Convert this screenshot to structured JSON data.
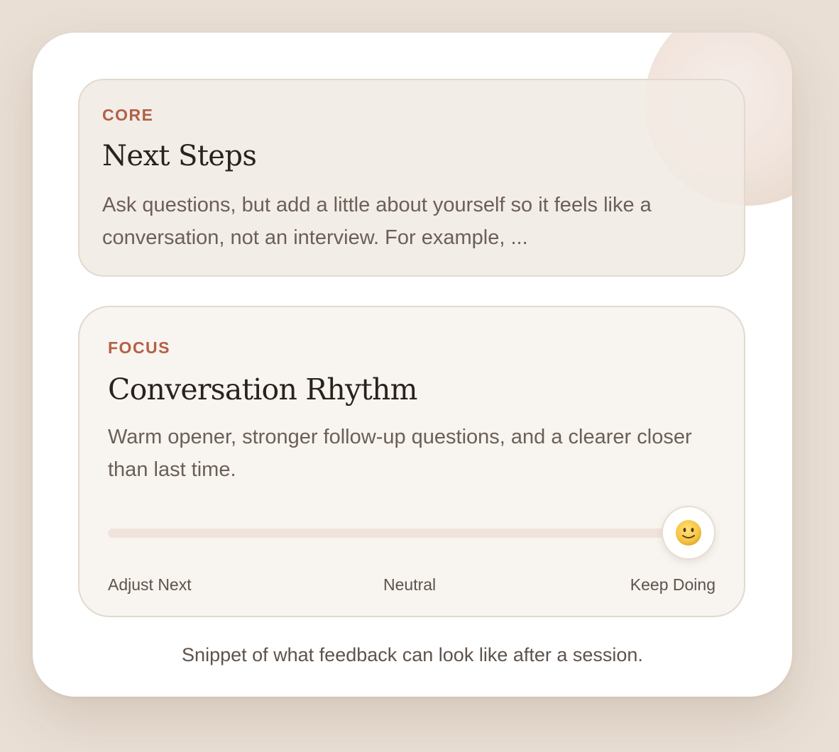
{
  "cards": {
    "core": {
      "eyebrow": "CORE",
      "title": "Next Steps",
      "body": "Ask questions, but add a little about yourself so it feels like a conversation, not an interview. For example, ..."
    },
    "focus": {
      "eyebrow": "FOCUS",
      "title": "Conversation Rhythm",
      "body": "Warm opener, stronger follow-up questions, and a clearer closer than last time.",
      "slider": {
        "value_percent": 100,
        "thumb_icon": "smiley-face-icon",
        "labels": {
          "left": "Adjust Next",
          "middle": "Neutral",
          "right": "Keep Doing"
        }
      }
    }
  },
  "caption": "Snippet of what feedback can look like after a session.",
  "colors": {
    "page_background": "#e9dfd5",
    "card_background": "#ffffff",
    "eyebrow_accent": "#b26047",
    "track": "#f1e3dc",
    "smiley_face": "#f5c542"
  }
}
